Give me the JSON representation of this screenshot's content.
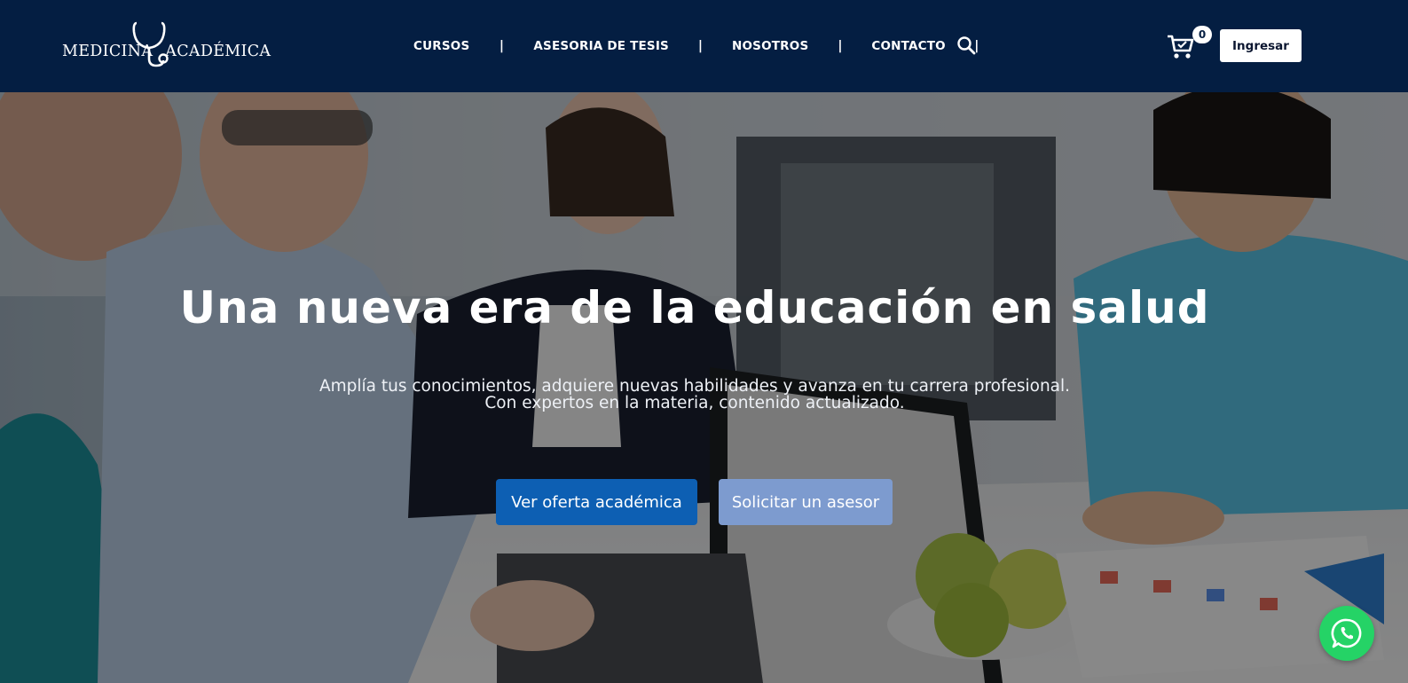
{
  "header": {
    "logo": {
      "word1": "MEDICINA",
      "word2": "ACADÉMICA"
    },
    "nav": [
      {
        "label": "CURSOS"
      },
      {
        "label": "ASESORIA DE TESIS"
      },
      {
        "label": "NOSOTROS"
      },
      {
        "label": "CONTACTO"
      }
    ],
    "separator": "|",
    "search_icon": "search-icon",
    "cart": {
      "icon": "cart-icon",
      "count": "0"
    },
    "login_label": "Ingresar"
  },
  "hero": {
    "title": "Una nueva era de la educación en salud",
    "subtitle_line1": "Amplía tus conocimientos, adquiere nuevas habilidades y avanza en tu carrera profesional.",
    "subtitle_line2": "Con expertos en la materia, contenido actualizado.",
    "primary_button": "Ver oferta académica",
    "secondary_button": "Solicitar un asesor"
  },
  "floating": {
    "whatsapp_icon": "whatsapp-icon"
  },
  "colors": {
    "header_bg": "#041e42",
    "primary_button": "#0d5fb3",
    "secondary_button": "#7d9bcf",
    "whatsapp": "#25d366"
  }
}
